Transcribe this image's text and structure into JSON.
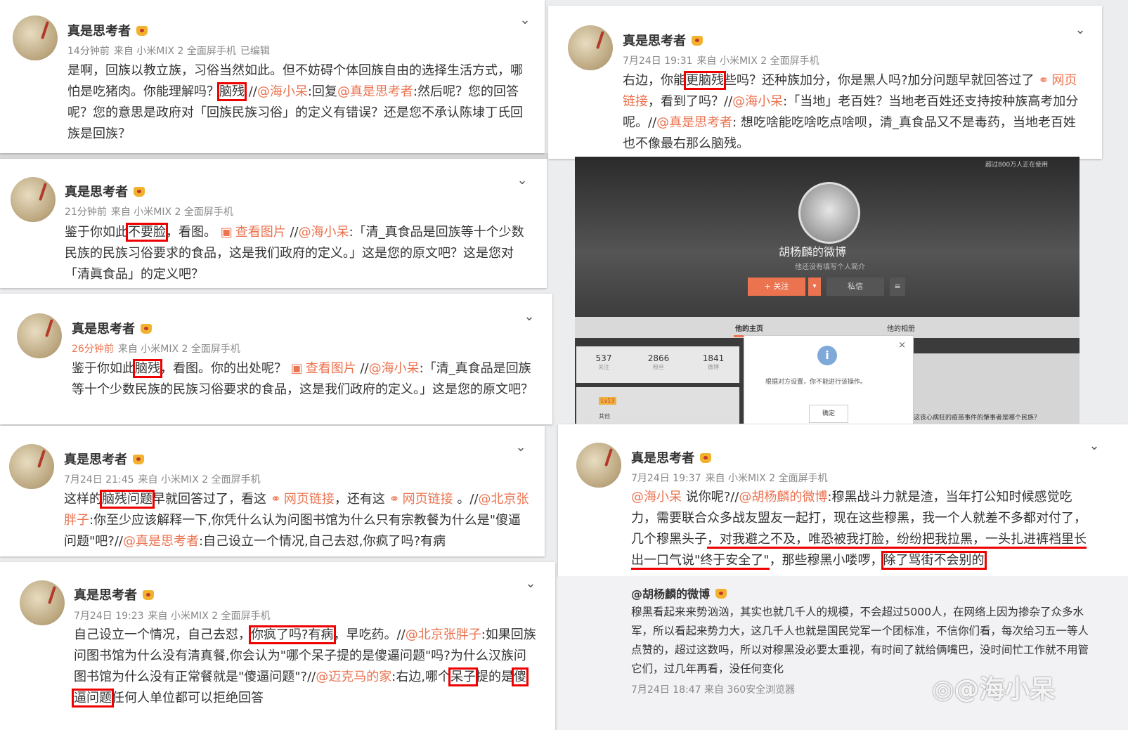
{
  "posts": [
    {
      "name": "真是思考者",
      "time": "14分钟前",
      "source": "来自 小米MIX 2 全面屏手机",
      "edited": "已编辑",
      "parts": [
        "是啊，回族以教立族，习俗当然如此。但不妨碍个体回族自由的选择生活方式，哪怕是吃猪肉。你能理解吗？",
        "脑残",
        " //",
        "@海小呆",
        ":回复",
        "@真是思考者",
        ":然后呢？您的回答呢？您的意思是政府对「回族民族习俗」的定义有错误？还是您不承认陈埭丁氏回族是回族？"
      ]
    },
    {
      "name": "真是思考者",
      "time": "21分钟前",
      "source": "来自 小米MIX 2 全面屏手机",
      "parts": [
        "鉴于你如此",
        "不要脸",
        "，看图。 ",
        "查看图片",
        " //",
        "@海小呆",
        ":「清_真食品是回族等十个少数民族的民族习俗要求的食品，这是我们政府的定义。」这是您的原文吧？这是您对「清眞食品」的定义吧？"
      ]
    },
    {
      "name": "真是思考者",
      "time": "26分钟前",
      "source": "来自 小米MIX 2 全面屏手机",
      "parts": [
        "鉴于你如此",
        "脑残",
        "，看图。你的出处呢？ ",
        "查看图片",
        " //",
        "@海小呆",
        ":「清_真食品是回族等十个少数民族的民族习俗要求的食品，这是我们政府的定义。」这是您的原文吧？"
      ]
    },
    {
      "name": "真是思考者",
      "time": "7月24日 21:45",
      "source": "来自 小米MIX 2 全面屏手机",
      "parts": [
        "这样的",
        "脑残问题",
        "早就回答过了，看这 ",
        "网页链接",
        "，还有这 ",
        "网页链接",
        " 。//",
        "@北京张胖子",
        ":你至少应该解释一下,你凭什么认为问图书馆为什么只有宗教餐为什么是\"傻逼问题\"吧?//",
        "@真是思考者",
        ":自己设立一个情况,自己去怼,你疯了吗?有病"
      ]
    },
    {
      "name": "真是思考者",
      "time": "7月24日 19:23",
      "source": "来自 小米MIX 2 全面屏手机",
      "parts": [
        "自己设立一个情况，自己去怼，",
        "你疯了吗?有病",
        "，早吃药。//",
        "@北京张胖子",
        ":如果回族问图书馆为什么没有清真餐,你会认为\"哪个呆子提的是傻逼问题\"吗?为什么汉族问图书馆为什么没有正常餐就是\"傻逼问题\"?//",
        "@迈克马的家",
        ":右边,哪个",
        "呆子",
        "提的是",
        "傻逼问题",
        "任何人单位都可以拒绝回答"
      ]
    },
    {
      "name": "真是思考者",
      "time": "7月24日 19:31",
      "source": "来自 小米MIX 2 全面屏手机",
      "parts": [
        "右边，你能",
        "更脑残",
        "些吗？还种族加分，你是黑人吗?加分问题早就回答过了 ",
        "网页链接",
        "，看到了吗？//",
        "@海小呆",
        ":「当地」老百姓？当地老百姓还支持按种族高考加分呢。//",
        "@真是思考者",
        ": 想吃啥能吃啥吃点啥呗，清_真食品又不是毒药，当地老百姓也不像最右那么脑残。"
      ]
    },
    {
      "name": "真是思考者",
      "time": "7月24日 19:37",
      "source": "来自 小米MIX 2 全面屏手机",
      "parts": [
        "@海小呆",
        " 说你呢?//",
        "@胡杨麟的微博",
        ":穆黑战斗力就是渣，当年打公知时候感觉吃力，需要联合众多战友盟友一起打，现在这些穆黑，我一个人就差不多都对付了，几个穆黑头子",
        "，对我避之不及，唯恐被我打脸，纷纷把我拉黑，一头扎进裤裆里长出一口气说\"终于安全了\"",
        "，那些穆黑小喽啰，",
        "除了骂街不会别的"
      ]
    }
  ],
  "quote": {
    "name": "@胡杨麟的微博",
    "text": "穆黑看起来来势汹汹，其实也就几千人的规模，不会超过5000人，在网络上因为掺杂了众多水军，所以看起来势力大，这几千人也就是国民党军一个团标准，不信你们看，每次给习五一等人点赞的，超过这数吗，所以对穆黑没必要太重视，有时间了就给俩嘴巴，没时间忙工作就不用管它们，过几年再看，没任何变化",
    "time": "7月24日 18:47",
    "source": "来自 360安全浏览器"
  },
  "screenshot": {
    "top_note": "超过800万人正在使用",
    "username": "胡杨麟的微博",
    "signature": "他还没有填写个人简介",
    "follow": "+ 关注",
    "dropdown": "▾",
    "message": "私信",
    "more": "≡",
    "tab_home": "他的主页",
    "tab_album": "他的相册",
    "stats": [
      {
        "value": "537",
        "label": "关注"
      },
      {
        "value": "2866",
        "label": "粉丝"
      },
      {
        "value": "1841",
        "label": "微博"
      }
    ],
    "level": "Lv13",
    "other": "其他",
    "dialog_msg": "根据对方设置，你不能进行该操作。",
    "dialog_ok": "确定",
    "dialog_close": "×",
    "info_glyph": "i",
    "feed_question": "这丧心病狂的疫苗事件的肇事者是哪个民族？"
  },
  "watermark": "@海小呆",
  "icons": {
    "chevron": "chevron-down-icon",
    "link": "link-icon",
    "image": "image-icon",
    "vip": "vip-badge-icon"
  },
  "colors": {
    "accent": "#eb7350",
    "highlight": "#e00000",
    "meta": "#888888"
  }
}
